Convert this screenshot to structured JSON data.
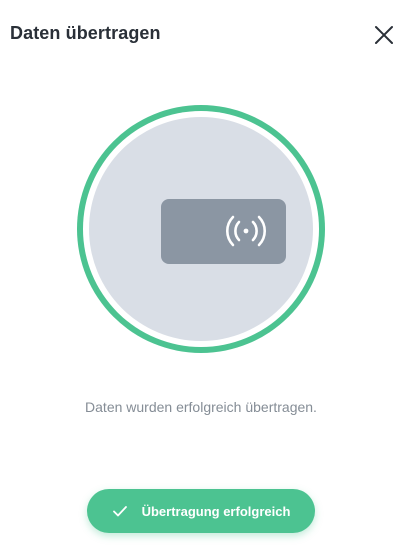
{
  "header": {
    "title": "Daten übertragen",
    "close_icon": "close-icon"
  },
  "illustration": {
    "icon": "nfc-contactless-icon",
    "ring_color": "#4cc391",
    "fill_color": "#d9dee6",
    "card_color": "#8b96a3"
  },
  "status": {
    "message": "Daten wurden erfolgreich übertragen."
  },
  "toast": {
    "icon": "checkmark-icon",
    "label": "Übertragung erfolgreich",
    "color": "#4cc391"
  }
}
